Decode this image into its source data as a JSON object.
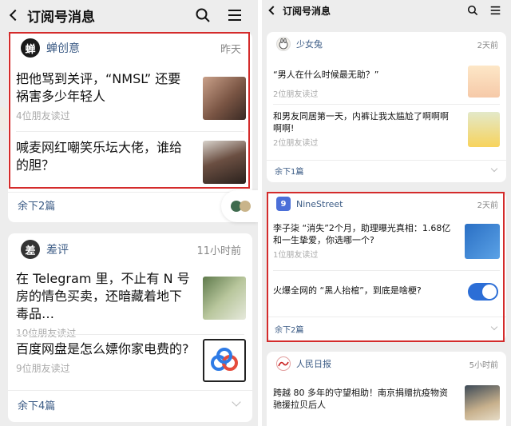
{
  "left": {
    "header": {
      "title": "订阅号消息"
    },
    "cards": [
      {
        "account": "蝉创意",
        "avatar_char": "蝉",
        "time": "昨天",
        "items": [
          {
            "title": "把他骂到关评，“NMSL” 还要祸害多少年轻人",
            "meta": "4位朋友读过"
          },
          {
            "title": "喊麦网红嘲笑乐坛大佬，谁给的胆？",
            "meta": ""
          }
        ],
        "more": "余下2篇"
      },
      {
        "account": "差评",
        "avatar_char": "差",
        "time": "11小时前",
        "items": [
          {
            "title": "在 Telegram 里，不止有 N 号房的情色买卖，还暗藏着地下毒品…",
            "meta": "10位朋友读过"
          },
          {
            "title": "百度网盘是怎么嫖你家电费的?",
            "meta": "9位朋友读过"
          }
        ],
        "more": "余下4篇"
      }
    ]
  },
  "right": {
    "header": {
      "title": "订阅号消息"
    },
    "cards": [
      {
        "account": "少女兔",
        "time": "2天前",
        "items": [
          {
            "title": "“男人在什么时候最无助？”",
            "meta": "2位朋友读过"
          },
          {
            "title": "和男友同居第一天，内裤让我太尴尬了啊啊啊啊啊!",
            "meta": "2位朋友读过"
          }
        ],
        "more": "余下1篇"
      },
      {
        "account": "NineStreet",
        "avatar_char": "9",
        "time": "2天前",
        "items": [
          {
            "title": "李子柒 “消失”2个月，助理曝光真相：1.68亿和一生挚爱，你选哪一个?",
            "meta": "1位朋友读过"
          },
          {
            "title": "火爆全网的 “黑人抬棺”，到底是啥梗?",
            "meta": ""
          }
        ],
        "more": "余下2篇"
      },
      {
        "account": "人民日报",
        "time": "5小时前",
        "items": [
          {
            "title": "跨越 80 多年的守望相助！南京捐赠抗疫物资驰援拉贝后人",
            "meta": ""
          }
        ]
      }
    ]
  },
  "colors": {
    "accent_link": "#3b5b85",
    "highlight": "#d42b2b",
    "toggle": "#2c6ed6"
  },
  "icons": [
    "back-arrow-icon",
    "search-icon",
    "menu-icon",
    "chevron-down-icon"
  ]
}
